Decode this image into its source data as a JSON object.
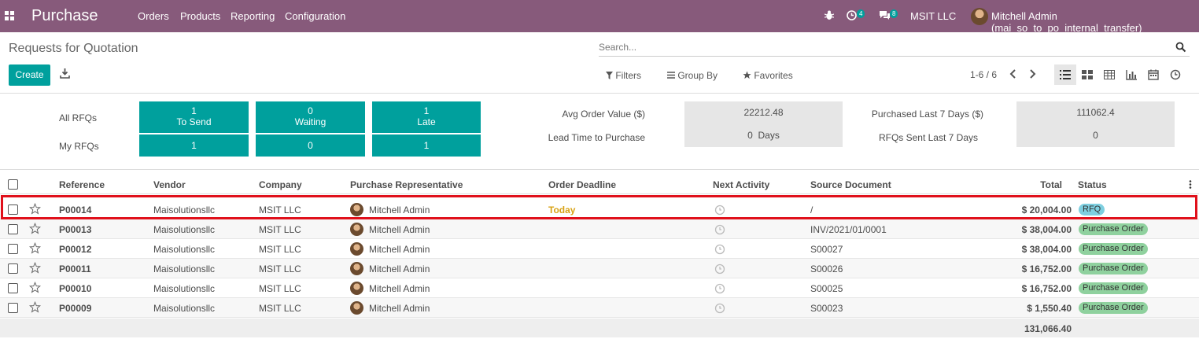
{
  "navbar": {
    "brand": "Purchase",
    "menus": [
      "Orders",
      "Products",
      "Reporting",
      "Configuration"
    ],
    "activity_count": "4",
    "message_count": "8",
    "company": "MSIT LLC",
    "user": "Mitchell Admin (mai_so_to_po_internal_transfer)",
    "color": "#875a7b"
  },
  "control_panel": {
    "title": "Requests for Quotation",
    "search_placeholder": "Search...",
    "create_label": "Create",
    "filters_label": "Filters",
    "groupby_label": "Group By",
    "favorites_label": "Favorites",
    "pager": "1-6 / 6",
    "active_view": "list"
  },
  "dashboard": {
    "all_rfqs_label": "All RFQs",
    "my_rfqs_label": "My RFQs",
    "tiles": [
      {
        "value": "1",
        "label": "To Send"
      },
      {
        "value": "0",
        "label": "Waiting"
      },
      {
        "value": "1",
        "label": "Late"
      }
    ],
    "my_tiles": [
      "1",
      "0",
      "1"
    ],
    "avg_order_label": "Avg Order Value ($)",
    "avg_order_value": "22212.48",
    "lead_time_label": "Lead Time to Purchase",
    "lead_time_value": "0  Days",
    "purchased_label": "Purchased Last 7 Days ($)",
    "purchased_value": "111062.4",
    "sent_label": "RFQs Sent Last 7 Days",
    "sent_value": "0",
    "accent": "#00a09d"
  },
  "table": {
    "headers": {
      "reference": "Reference",
      "vendor": "Vendor",
      "company": "Company",
      "rep": "Purchase Representative",
      "deadline": "Order Deadline",
      "activity": "Next Activity",
      "source": "Source Document",
      "total": "Total",
      "status": "Status"
    },
    "rows": [
      {
        "ref": "P00014",
        "vendor": "Maisolutionsllc",
        "company": "MSIT LLC",
        "rep": "Mitchell Admin",
        "deadline": "Today",
        "source": "/",
        "total": "$ 20,004.00",
        "status": "RFQ"
      },
      {
        "ref": "P00013",
        "vendor": "Maisolutionsllc",
        "company": "MSIT LLC",
        "rep": "Mitchell Admin",
        "deadline": "",
        "source": "INV/2021/01/0001",
        "total": "$ 38,004.00",
        "status": "Purchase Order"
      },
      {
        "ref": "P00012",
        "vendor": "Maisolutionsllc",
        "company": "MSIT LLC",
        "rep": "Mitchell Admin",
        "deadline": "",
        "source": "S00027",
        "total": "$ 38,004.00",
        "status": "Purchase Order"
      },
      {
        "ref": "P00011",
        "vendor": "Maisolutionsllc",
        "company": "MSIT LLC",
        "rep": "Mitchell Admin",
        "deadline": "",
        "source": "S00026",
        "total": "$ 16,752.00",
        "status": "Purchase Order"
      },
      {
        "ref": "P00010",
        "vendor": "Maisolutionsllc",
        "company": "MSIT LLC",
        "rep": "Mitchell Admin",
        "deadline": "",
        "source": "S00025",
        "total": "$ 16,752.00",
        "status": "Purchase Order"
      },
      {
        "ref": "P00009",
        "vendor": "Maisolutionsllc",
        "company": "MSIT LLC",
        "rep": "Mitchell Admin",
        "deadline": "",
        "source": "S00023",
        "total": "$ 1,550.40",
        "status": "Purchase Order"
      }
    ],
    "grand_total": "131,066.40",
    "highlight_color": "#e0101b"
  }
}
